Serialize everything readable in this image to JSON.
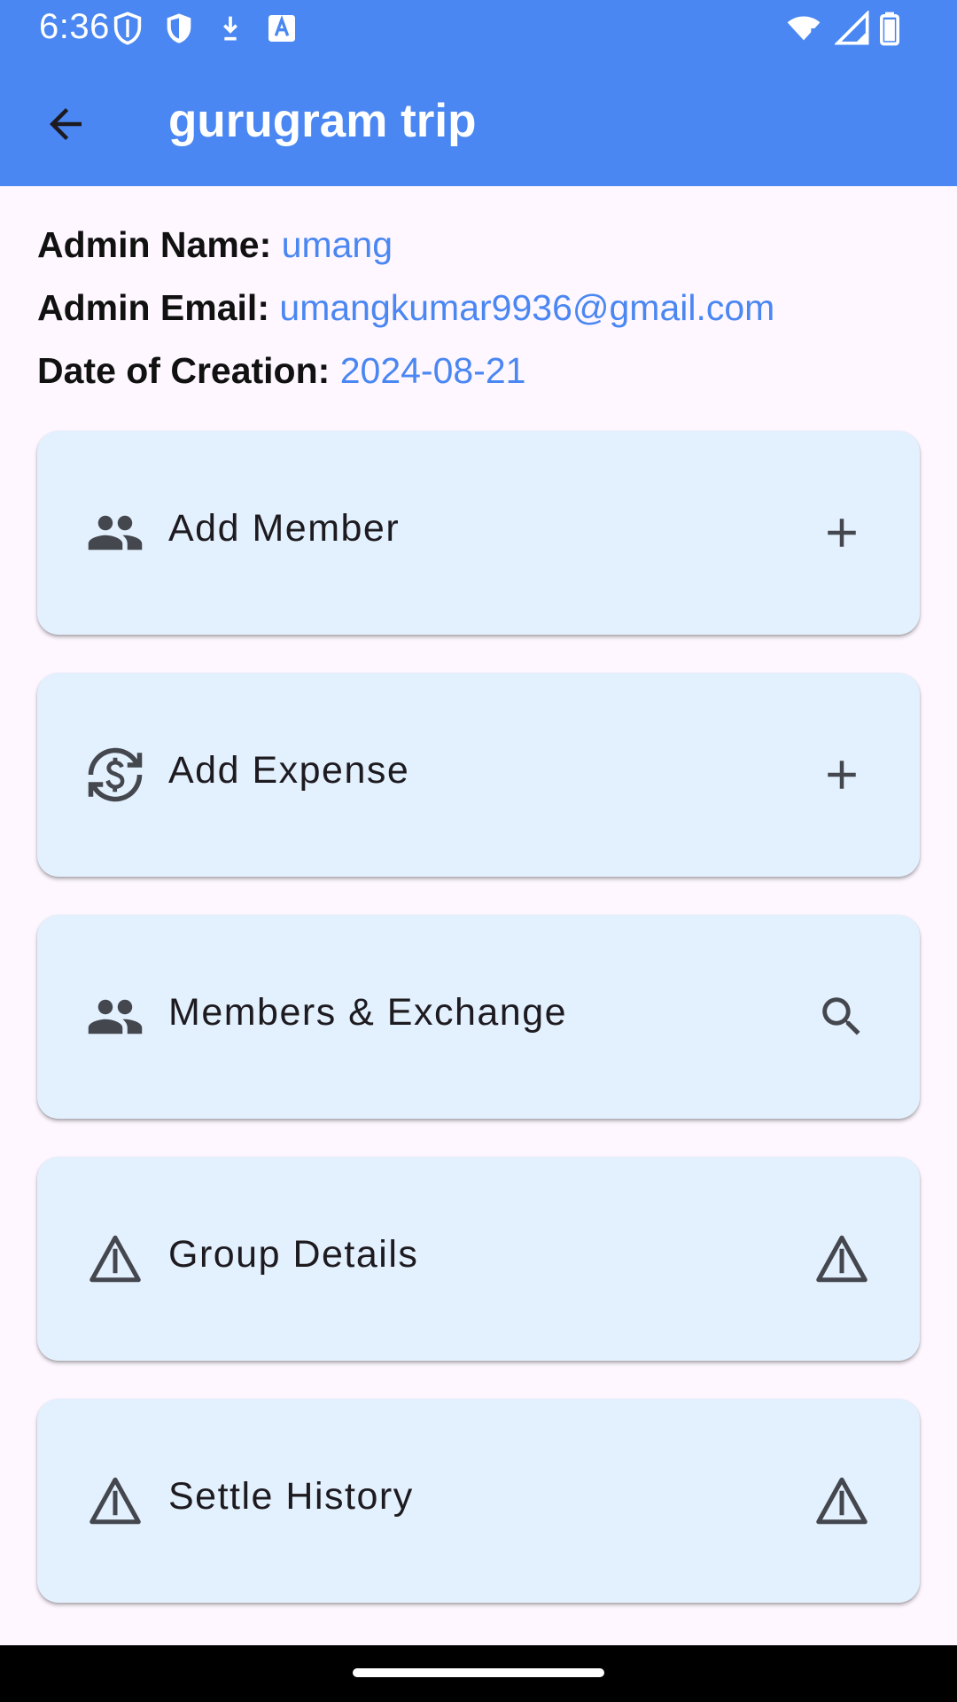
{
  "status_bar": {
    "time": "6:36",
    "left_icons": [
      "shield-outline-icon",
      "shield-filled-icon",
      "download-icon",
      "font-a-icon"
    ],
    "right_icons": [
      "wifi-icon",
      "cell-signal-icon",
      "battery-icon"
    ]
  },
  "app_bar": {
    "title": "gurugram trip",
    "back_icon": "arrow-back-icon",
    "background": "#4A87F2"
  },
  "info": [
    {
      "key": "Admin Name:",
      "value": "umang"
    },
    {
      "key": "Admin Email:",
      "value": "umangkumar9936@gmail.com"
    },
    {
      "key": "Date of Creation:",
      "value": "2024-08-21"
    }
  ],
  "cards": [
    {
      "label": "Add Member",
      "lead_icon": "group-icon",
      "trail_icon": "plus-icon"
    },
    {
      "label": "Add Expense",
      "lead_icon": "currency-exchange-icon",
      "trail_icon": "plus-icon"
    },
    {
      "label": "Members & Exchange",
      "lead_icon": "group-icon",
      "trail_icon": "search-icon"
    },
    {
      "label": "Group Details",
      "lead_icon": "warning-triangle-icon",
      "trail_icon": "warning-triangle-icon"
    },
    {
      "label": "Settle History",
      "lead_icon": "warning-triangle-icon",
      "trail_icon": "warning-triangle-icon"
    }
  ],
  "colors": {
    "accent": "#4A87F2",
    "card_background": "#E3F0FD",
    "page_background": "#FEF7FF"
  }
}
